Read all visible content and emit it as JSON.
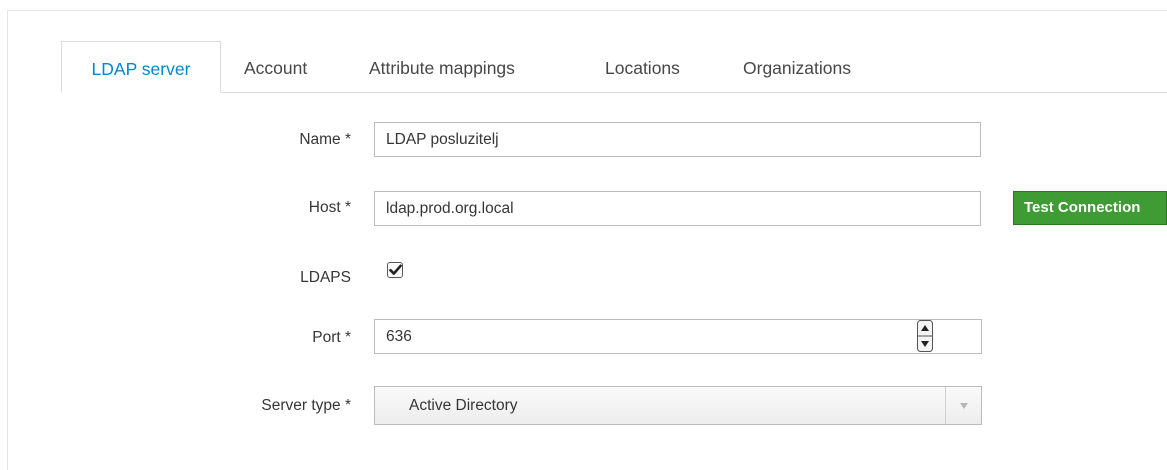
{
  "tabs": [
    {
      "label": "LDAP server",
      "active": true
    },
    {
      "label": "Account",
      "active": false
    },
    {
      "label": "Attribute mappings",
      "active": false
    },
    {
      "label": "Locations",
      "active": false
    },
    {
      "label": "Organizations",
      "active": false
    }
  ],
  "form": {
    "name": {
      "label": "Name *",
      "value": "LDAP posluzitelj"
    },
    "host": {
      "label": "Host *",
      "value": "ldap.prod.org.local",
      "test_button": "Test Connection"
    },
    "ldaps": {
      "label": "LDAPS",
      "checked": true
    },
    "port": {
      "label": "Port *",
      "value": "636"
    },
    "server_type": {
      "label": "Server type *",
      "value": "Active Directory"
    }
  },
  "colors": {
    "active_tab": "#0088ce",
    "test_button": "#3f9c35"
  },
  "icons": {
    "ldaps_checkbox": "checkmark-icon",
    "port_spinner": "spinner-arrows-icon",
    "select_caret": "chevron-down-icon"
  }
}
